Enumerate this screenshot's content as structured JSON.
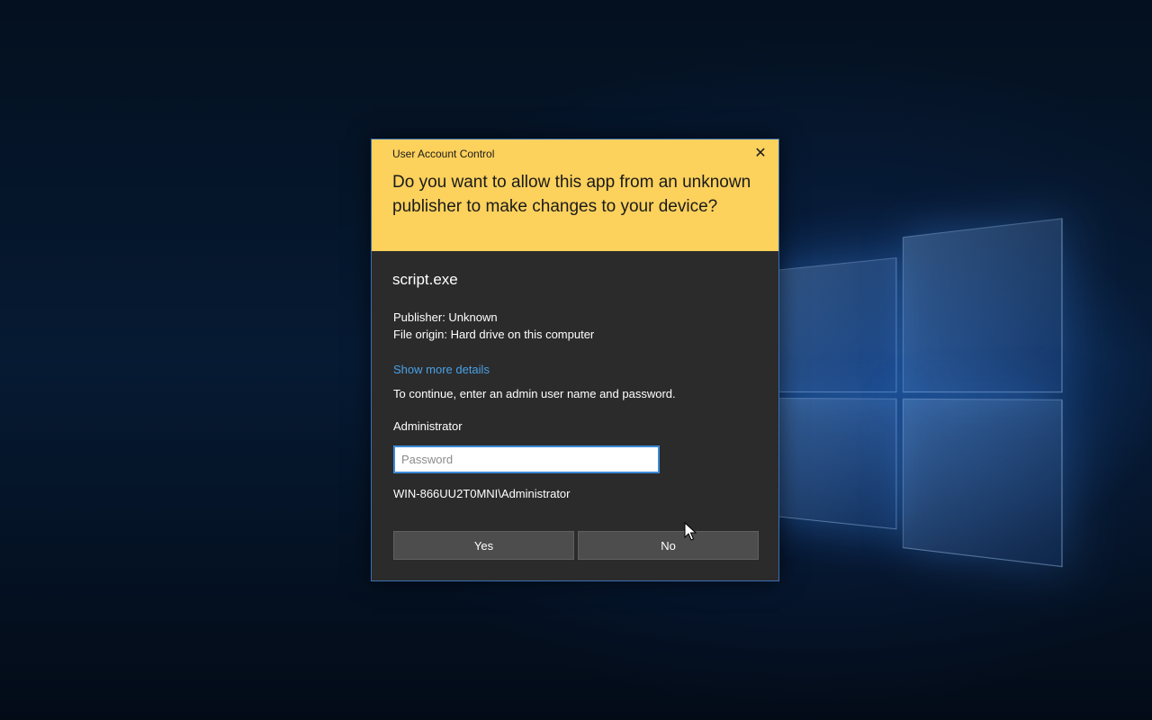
{
  "dialog": {
    "window_title": "User Account Control",
    "close_glyph": "✕",
    "question": "Do you want to allow this app from an unknown publisher to make changes to your device?",
    "app_name": "script.exe",
    "publisher": "Publisher: Unknown",
    "file_origin": "File origin: Hard drive on this computer",
    "details_link": "Show more details",
    "instruction": "To continue, enter an admin user name and password.",
    "user_label": "Administrator",
    "password_placeholder": "Password",
    "password_value": "",
    "domain_user": "WIN-866UU2T0MNI\\Administrator",
    "yes_label": "Yes",
    "no_label": "No"
  },
  "colors": {
    "header_background": "#fcd15c",
    "body_background": "#2b2b2b",
    "link": "#4aa0e6",
    "button": "#4d4d4d",
    "input_border": "#3c8ad8"
  },
  "icons": {
    "close": "close-icon",
    "cursor": "mouse-pointer-icon",
    "background_logo": "windows-logo"
  }
}
